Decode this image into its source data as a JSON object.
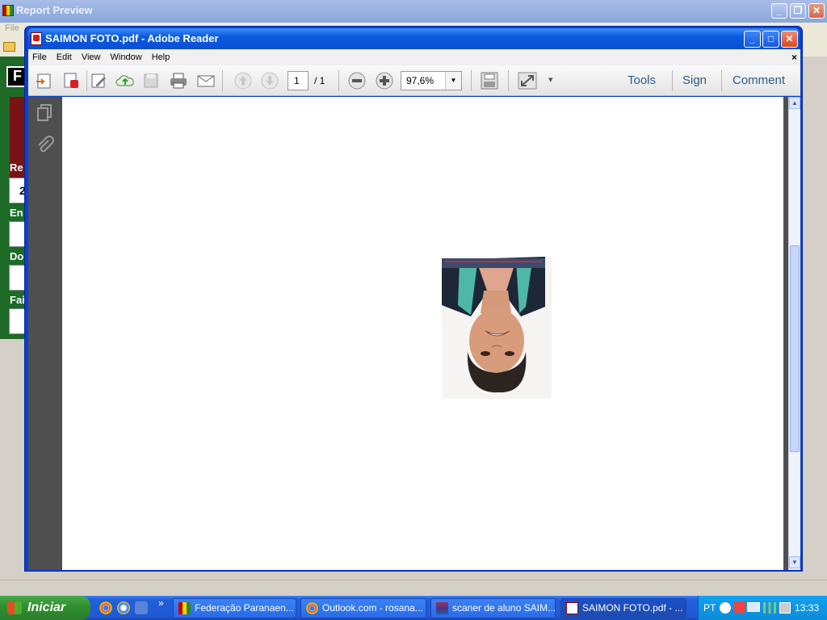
{
  "background_window": {
    "title": "Report Preview",
    "menu_file": "File",
    "form_letters": [
      "F",
      "Re",
      "2",
      "En",
      "Do",
      "Fai"
    ],
    "buttons": {
      "minimize": "_",
      "restore": "❐",
      "close": "✕"
    }
  },
  "reader": {
    "title": "SAIMON FOTO.pdf - Adobe Reader",
    "buttons": {
      "minimize": "_",
      "maximize": "□",
      "close": "✕"
    },
    "menu": [
      "File",
      "Edit",
      "View",
      "Window",
      "Help"
    ],
    "menu_close": "×",
    "toolbar": {
      "page_current": "1",
      "page_total": "/ 1",
      "zoom": "97,6%",
      "zoom_arrow": "▼",
      "overflow_arrow": "▾",
      "tools": "Tools",
      "sign": "Sign",
      "comment": "Comment"
    },
    "scrollbar": {
      "up": "▲",
      "down": "▼"
    }
  },
  "taskbar": {
    "start": "Iniciar",
    "tasks": [
      {
        "label": "Federação Paranaen..."
      },
      {
        "label": "Outlook.com - rosana..."
      },
      {
        "label": "scaner de aluno SAIM..."
      },
      {
        "label": "SAIMON FOTO.pdf - ..."
      }
    ],
    "overflow": "»",
    "lang": "PT",
    "clock": "13:33"
  },
  "colors": {
    "taskbar_blue": "#245edb",
    "start_green": "#2f8f2f",
    "reader_title_blue": "#0b5be0"
  }
}
